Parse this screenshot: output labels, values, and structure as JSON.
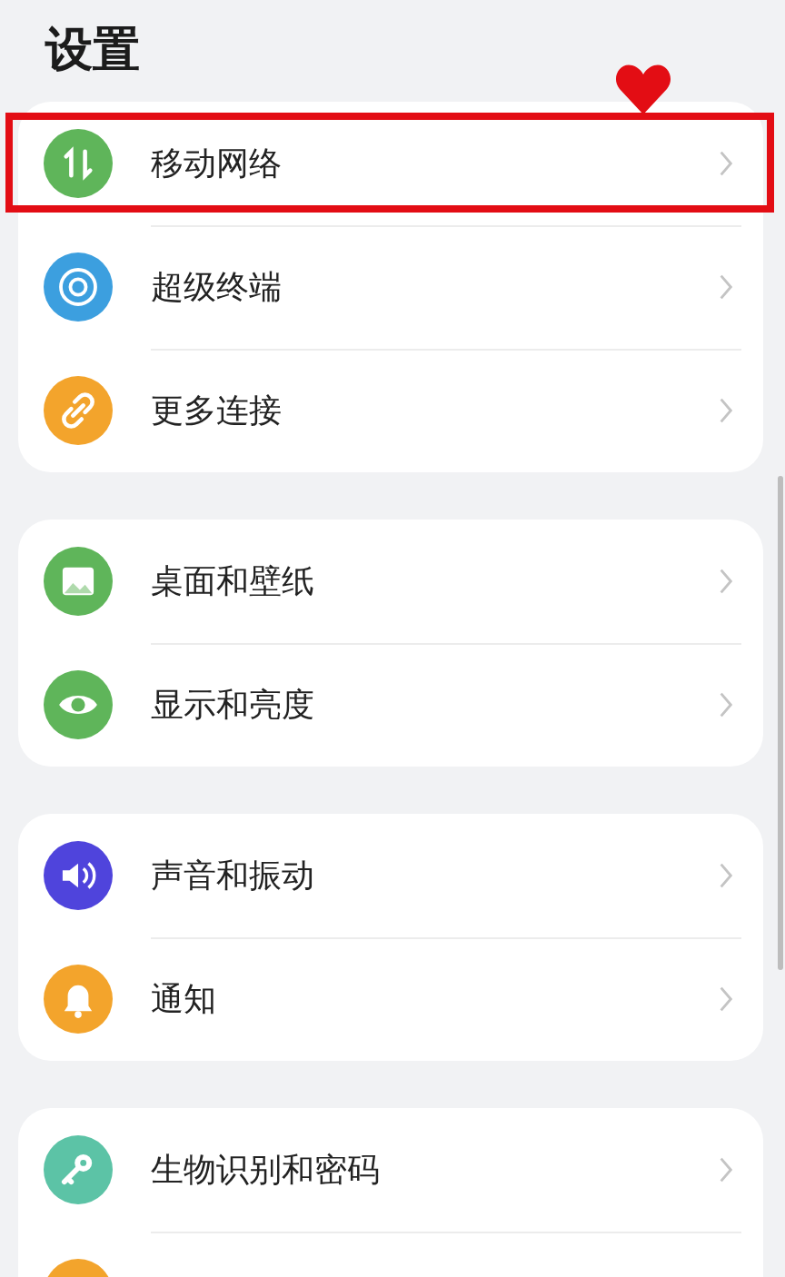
{
  "title": "设置",
  "groups": [
    {
      "items": [
        {
          "label": "移动网络",
          "kind": "data",
          "color": "#5fb55a",
          "highlighted": true
        },
        {
          "label": "超级终端",
          "kind": "terminal",
          "color": "#3c9fdf",
          "highlighted": false
        },
        {
          "label": "更多连接",
          "kind": "link",
          "color": "#f3a42c",
          "highlighted": false
        }
      ]
    },
    {
      "items": [
        {
          "label": "桌面和壁纸",
          "kind": "image",
          "color": "#5fb55a",
          "highlighted": false
        },
        {
          "label": "显示和亮度",
          "kind": "eye",
          "color": "#5fb55a",
          "highlighted": false
        }
      ]
    },
    {
      "items": [
        {
          "label": "声音和振动",
          "kind": "speaker",
          "color": "#4f44dc",
          "highlighted": false
        },
        {
          "label": "通知",
          "kind": "bell",
          "color": "#f3a42c",
          "highlighted": false
        }
      ]
    },
    {
      "items": [
        {
          "label": "生物识别和密码",
          "kind": "key",
          "color": "#5cc3a6",
          "highlighted": false
        },
        {
          "kind": "blank",
          "color": "#f3a42c",
          "highlighted": false
        }
      ]
    }
  ]
}
